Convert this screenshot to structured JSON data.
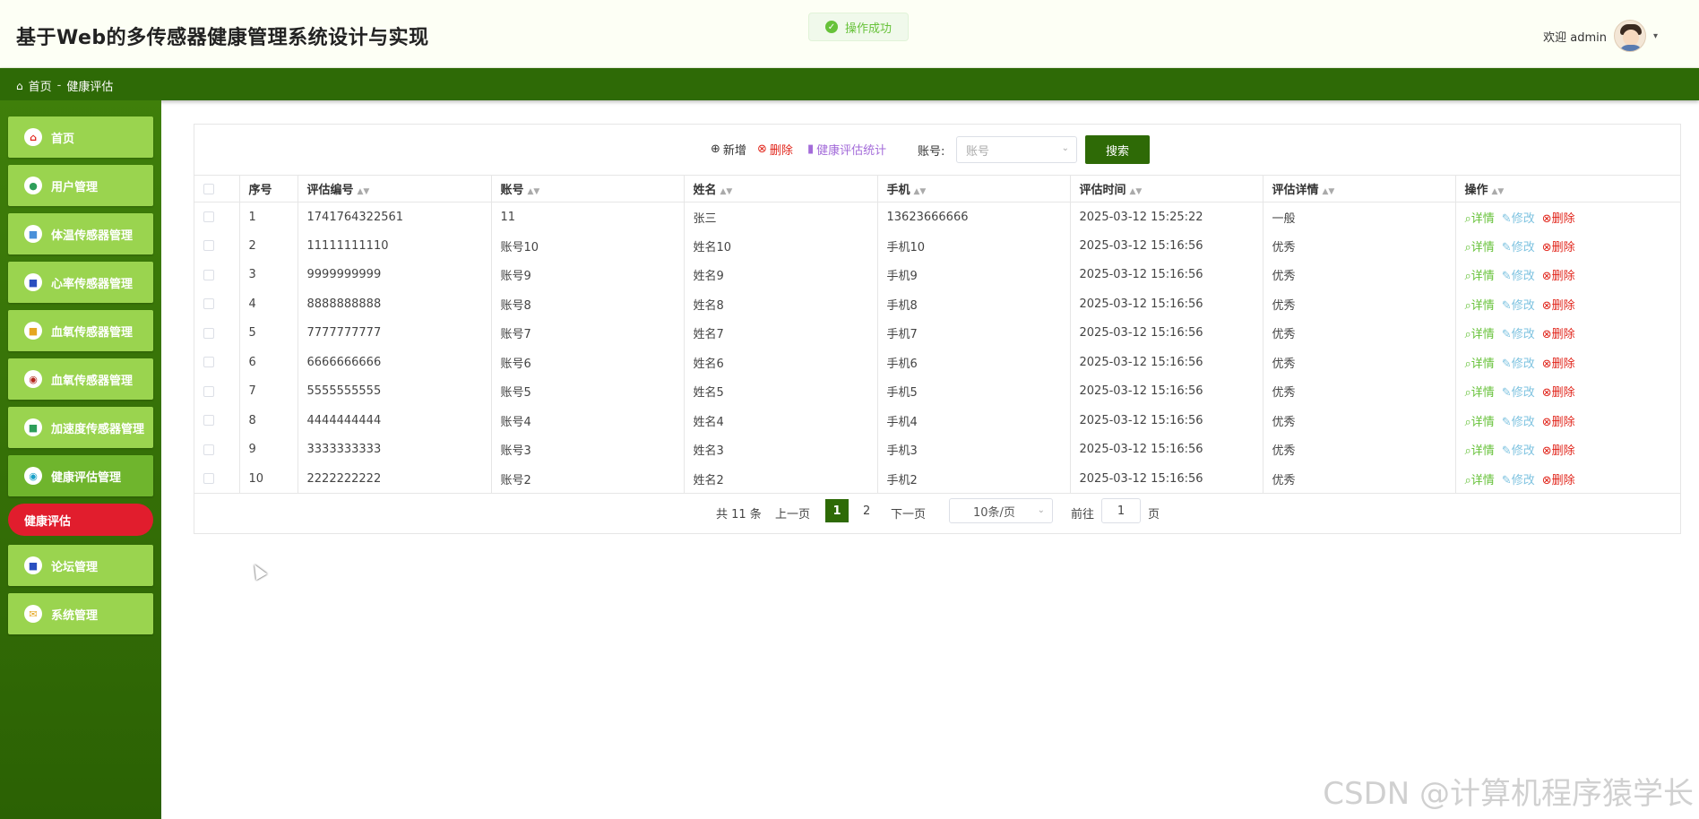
{
  "header": {
    "title": "基于Web的多传感器健康管理系统设计与实现",
    "toast": "操作成功",
    "welcome": "欢迎 admin"
  },
  "breadcrumb": {
    "home": "首页",
    "separator": "-",
    "current": "健康评估"
  },
  "sidebar": {
    "items": [
      {
        "label": "首页",
        "icon": "home-icon"
      },
      {
        "label": "用户管理",
        "icon": "user-icon"
      },
      {
        "label": "体温传感器管理",
        "icon": "thermometer-icon"
      },
      {
        "label": "心率传感器管理",
        "icon": "heart-rate-icon"
      },
      {
        "label": "血氧传感器管理",
        "icon": "oxygen-icon"
      },
      {
        "label": "血氧传感器管理",
        "icon": "pressure-icon"
      },
      {
        "label": "加速度传感器管理",
        "icon": "accelerometer-icon"
      },
      {
        "label": "健康评估管理",
        "icon": "assessment-icon"
      },
      {
        "label": "论坛管理",
        "icon": "forum-icon"
      },
      {
        "label": "系统管理",
        "icon": "settings-icon"
      }
    ],
    "submenu_active": "健康评估"
  },
  "toolbar": {
    "add": "新增",
    "delete": "删除",
    "stats": "健康评估统计",
    "account_label": "账号:",
    "account_placeholder": "账号",
    "search": "搜索"
  },
  "table": {
    "headers": [
      "序号",
      "评估编号",
      "账号",
      "姓名",
      "手机",
      "评估时间",
      "评估详情",
      "操作"
    ],
    "ops": {
      "detail": "详情",
      "edit": "修改",
      "delete": "删除"
    },
    "rows": [
      [
        "1",
        "1741764322561",
        "11",
        "张三",
        "13623666666",
        "2025-03-12 15:25:22",
        "一般"
      ],
      [
        "2",
        "11111111110",
        "账号10",
        "姓名10",
        "手机10",
        "2025-03-12 15:16:56",
        "优秀"
      ],
      [
        "3",
        "9999999999",
        "账号9",
        "姓名9",
        "手机9",
        "2025-03-12 15:16:56",
        "优秀"
      ],
      [
        "4",
        "8888888888",
        "账号8",
        "姓名8",
        "手机8",
        "2025-03-12 15:16:56",
        "优秀"
      ],
      [
        "5",
        "7777777777",
        "账号7",
        "姓名7",
        "手机7",
        "2025-03-12 15:16:56",
        "优秀"
      ],
      [
        "6",
        "6666666666",
        "账号6",
        "姓名6",
        "手机6",
        "2025-03-12 15:16:56",
        "优秀"
      ],
      [
        "7",
        "5555555555",
        "账号5",
        "姓名5",
        "手机5",
        "2025-03-12 15:16:56",
        "优秀"
      ],
      [
        "8",
        "4444444444",
        "账号4",
        "姓名4",
        "手机4",
        "2025-03-12 15:16:56",
        "优秀"
      ],
      [
        "9",
        "3333333333",
        "账号3",
        "姓名3",
        "手机3",
        "2025-03-12 15:16:56",
        "优秀"
      ],
      [
        "10",
        "2222222222",
        "账号2",
        "姓名2",
        "手机2",
        "2025-03-12 15:16:56",
        "优秀"
      ]
    ]
  },
  "pagination": {
    "total": "共 11 条",
    "prev": "上一页",
    "current_page": "1",
    "page_2": "2",
    "next": "下一页",
    "page_size": "10条/页",
    "goto_label": "前往",
    "goto_value": "1",
    "goto_unit": "页"
  },
  "watermark": "CSDN @计算机程序猿学长",
  "colors": {
    "primary": "#2e6a06",
    "menu": "#9ad44f",
    "active_submenu": "#e11d2d"
  }
}
